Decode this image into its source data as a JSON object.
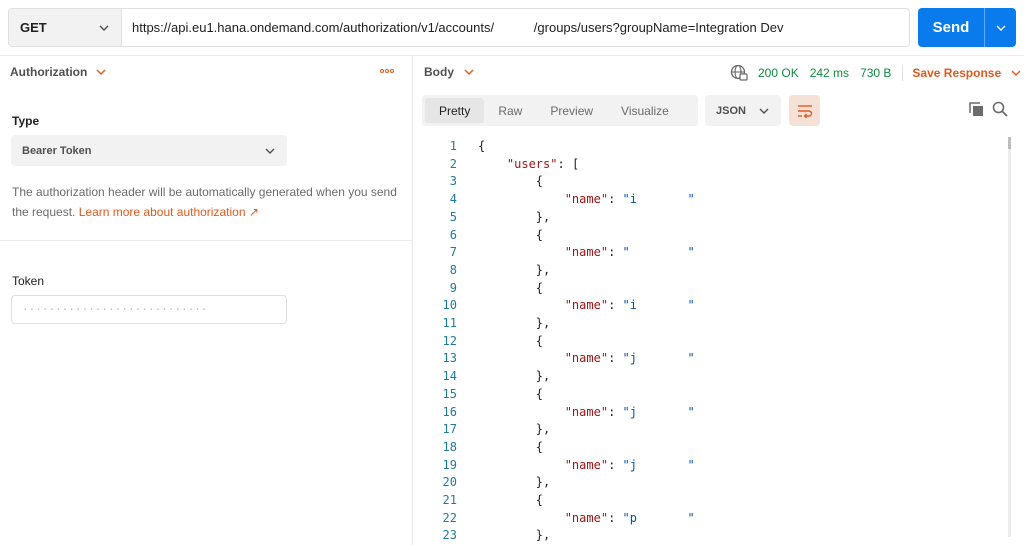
{
  "request": {
    "method": "GET",
    "url": "https://api.eu1.hana.ondemand.com/authorization/v1/accounts/           /groups/users?groupName=Integration Dev",
    "send_label": "Send"
  },
  "auth": {
    "tab_label": "Authorization",
    "type_label": "Type",
    "type_value": "Bearer Token",
    "description": "The authorization header will be automatically generated when you send the request.",
    "learn_more": "Learn more about authorization ↗",
    "token_label": "Token",
    "token_value": "····························"
  },
  "response": {
    "body_label": "Body",
    "status": "200 OK",
    "time": "242 ms",
    "size": "730 B",
    "save_label": "Save Response",
    "tabs": [
      "Pretty",
      "Raw",
      "Preview",
      "Visualize"
    ],
    "active_tab": "Pretty",
    "format": "JSON"
  },
  "code_lines": [
    {
      "n": "1",
      "t": "{"
    },
    {
      "n": "2",
      "t": "    \"users\": ["
    },
    {
      "n": "3",
      "t": "        {"
    },
    {
      "n": "4",
      "t": "            \"name\": \"i       \""
    },
    {
      "n": "5",
      "t": "        },"
    },
    {
      "n": "6",
      "t": "        {"
    },
    {
      "n": "7",
      "t": "            \"name\": \"        \""
    },
    {
      "n": "8",
      "t": "        },"
    },
    {
      "n": "9",
      "t": "        {"
    },
    {
      "n": "10",
      "t": "            \"name\": \"i       \""
    },
    {
      "n": "11",
      "t": "        },"
    },
    {
      "n": "12",
      "t": "        {"
    },
    {
      "n": "13",
      "t": "            \"name\": \"j       \""
    },
    {
      "n": "14",
      "t": "        },"
    },
    {
      "n": "15",
      "t": "        {"
    },
    {
      "n": "16",
      "t": "            \"name\": \"j       \""
    },
    {
      "n": "17",
      "t": "        },"
    },
    {
      "n": "18",
      "t": "        {"
    },
    {
      "n": "19",
      "t": "            \"name\": \"j       \""
    },
    {
      "n": "20",
      "t": "        },"
    },
    {
      "n": "21",
      "t": "        {"
    },
    {
      "n": "22",
      "t": "            \"name\": \"p       \""
    },
    {
      "n": "23",
      "t": "        },"
    }
  ],
  "colors": {
    "accent": "#097bed",
    "brand_orange": "#e0591f",
    "status_green": "#0f8a3f"
  }
}
